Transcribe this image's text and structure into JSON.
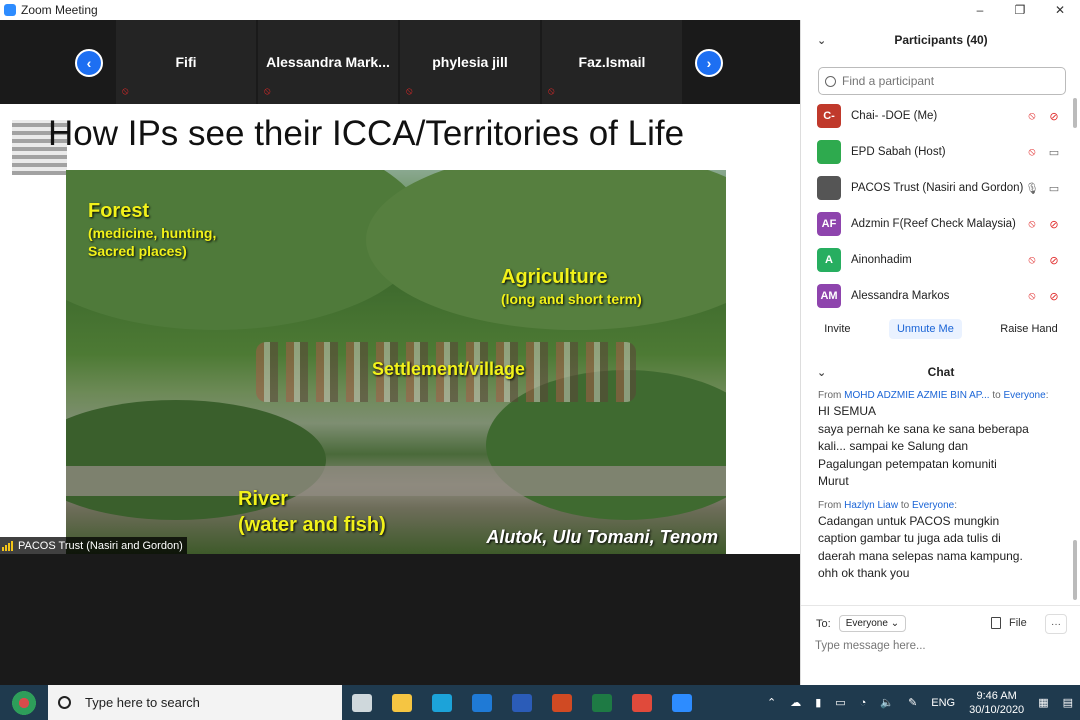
{
  "window": {
    "title": "Zoom Meeting",
    "controls": [
      "–",
      "❐",
      "✕"
    ]
  },
  "gallery": {
    "tiles": [
      {
        "name": "Fifi"
      },
      {
        "name": "Alessandra  Mark..."
      },
      {
        "name": "phylesia jill"
      },
      {
        "name": "Faz.Ismail"
      }
    ],
    "prev_icon": "chevron-left-icon",
    "next_icon": "chevron-right-icon"
  },
  "slide": {
    "title": "How IPs see their ICCA/Territories of Life",
    "labels": {
      "forest_title": "Forest",
      "forest_sub1": "(medicine, hunting,",
      "forest_sub2": "Sacred places)",
      "agri_title": "Agriculture",
      "agri_sub": "(long and short term)",
      "settlement": "Settlement/village",
      "river_title": "River",
      "river_sub": "(water and fish)"
    },
    "caption": "Alutok, Ulu Tomani, Tenom"
  },
  "speaker_tag": "PACOS Trust (Nasiri and Gordon)",
  "participants": {
    "header": "Participants (40)",
    "search_placeholder": "Find a participant",
    "list": [
      {
        "initials": "C-",
        "name": "Chai- -DOE (Me)",
        "color": "#c0392b",
        "mic": "muted",
        "cam": "off"
      },
      {
        "initials": "",
        "name": "EPD Sabah (Host)",
        "color": "#2eaa4e",
        "mic": "muted",
        "cam": "on"
      },
      {
        "initials": "",
        "name": "PACOS Trust (Nasiri and Gordon)",
        "color": "#555555",
        "mic": "on",
        "cam": "on"
      },
      {
        "initials": "AF",
        "name": "Adzmin F(Reef Check Malaysia)",
        "color": "#8e44ad",
        "mic": "muted",
        "cam": "off"
      },
      {
        "initials": "A",
        "name": "Ainonhadim",
        "color": "#27ae60",
        "mic": "muted",
        "cam": "off"
      },
      {
        "initials": "AM",
        "name": "Alessandra Markos",
        "color": "#8e44ad",
        "mic": "muted",
        "cam": "off"
      }
    ],
    "buttons": {
      "invite": "Invite",
      "unmute": "Unmute Me",
      "raise": "Raise Hand"
    }
  },
  "chat": {
    "header": "Chat",
    "messages": [
      {
        "from_prefix": "From",
        "sender": "MOHD ADZMIE AZMIE BIN AP...",
        "to_word": "to",
        "recipient": "Everyone",
        "suffix": ":",
        "lines": [
          "HI SEMUA",
          "saya pernah ke sana ke sana beberapa",
          "kali... sampai ke Salung dan",
          "Pagalungan petempatan komuniti",
          "Murut"
        ]
      },
      {
        "from_prefix": "From",
        "sender": "Hazlyn Liaw",
        "to_word": "to",
        "recipient": "Everyone",
        "suffix": ":",
        "lines": [
          "Cadangan untuk PACOS mungkin",
          "caption gambar tu juga ada tulis di",
          "daerah mana selepas nama kampung.",
          "ohh ok thank you"
        ]
      }
    ],
    "to_label": "To:",
    "to_value": "Everyone",
    "file_label": "File",
    "more_label": "···",
    "input_placeholder": "Type message here..."
  },
  "taskbar": {
    "search_placeholder": "Type here to search",
    "apps": [
      {
        "name": "task-view",
        "color": "#cfd8dc"
      },
      {
        "name": "file-explorer",
        "color": "#f5c542"
      },
      {
        "name": "edge",
        "color": "#1ca3d9"
      },
      {
        "name": "mail",
        "color": "#1f7ad6"
      },
      {
        "name": "word",
        "color": "#2b5cb8"
      },
      {
        "name": "powerpoint",
        "color": "#d04a23"
      },
      {
        "name": "excel",
        "color": "#1e7a44"
      },
      {
        "name": "chrome",
        "color": "#e04a3b"
      },
      {
        "name": "zoom",
        "color": "#2d8cff"
      }
    ],
    "lang": "ENG",
    "time": "9:46 AM",
    "date": "30/10/2020"
  }
}
